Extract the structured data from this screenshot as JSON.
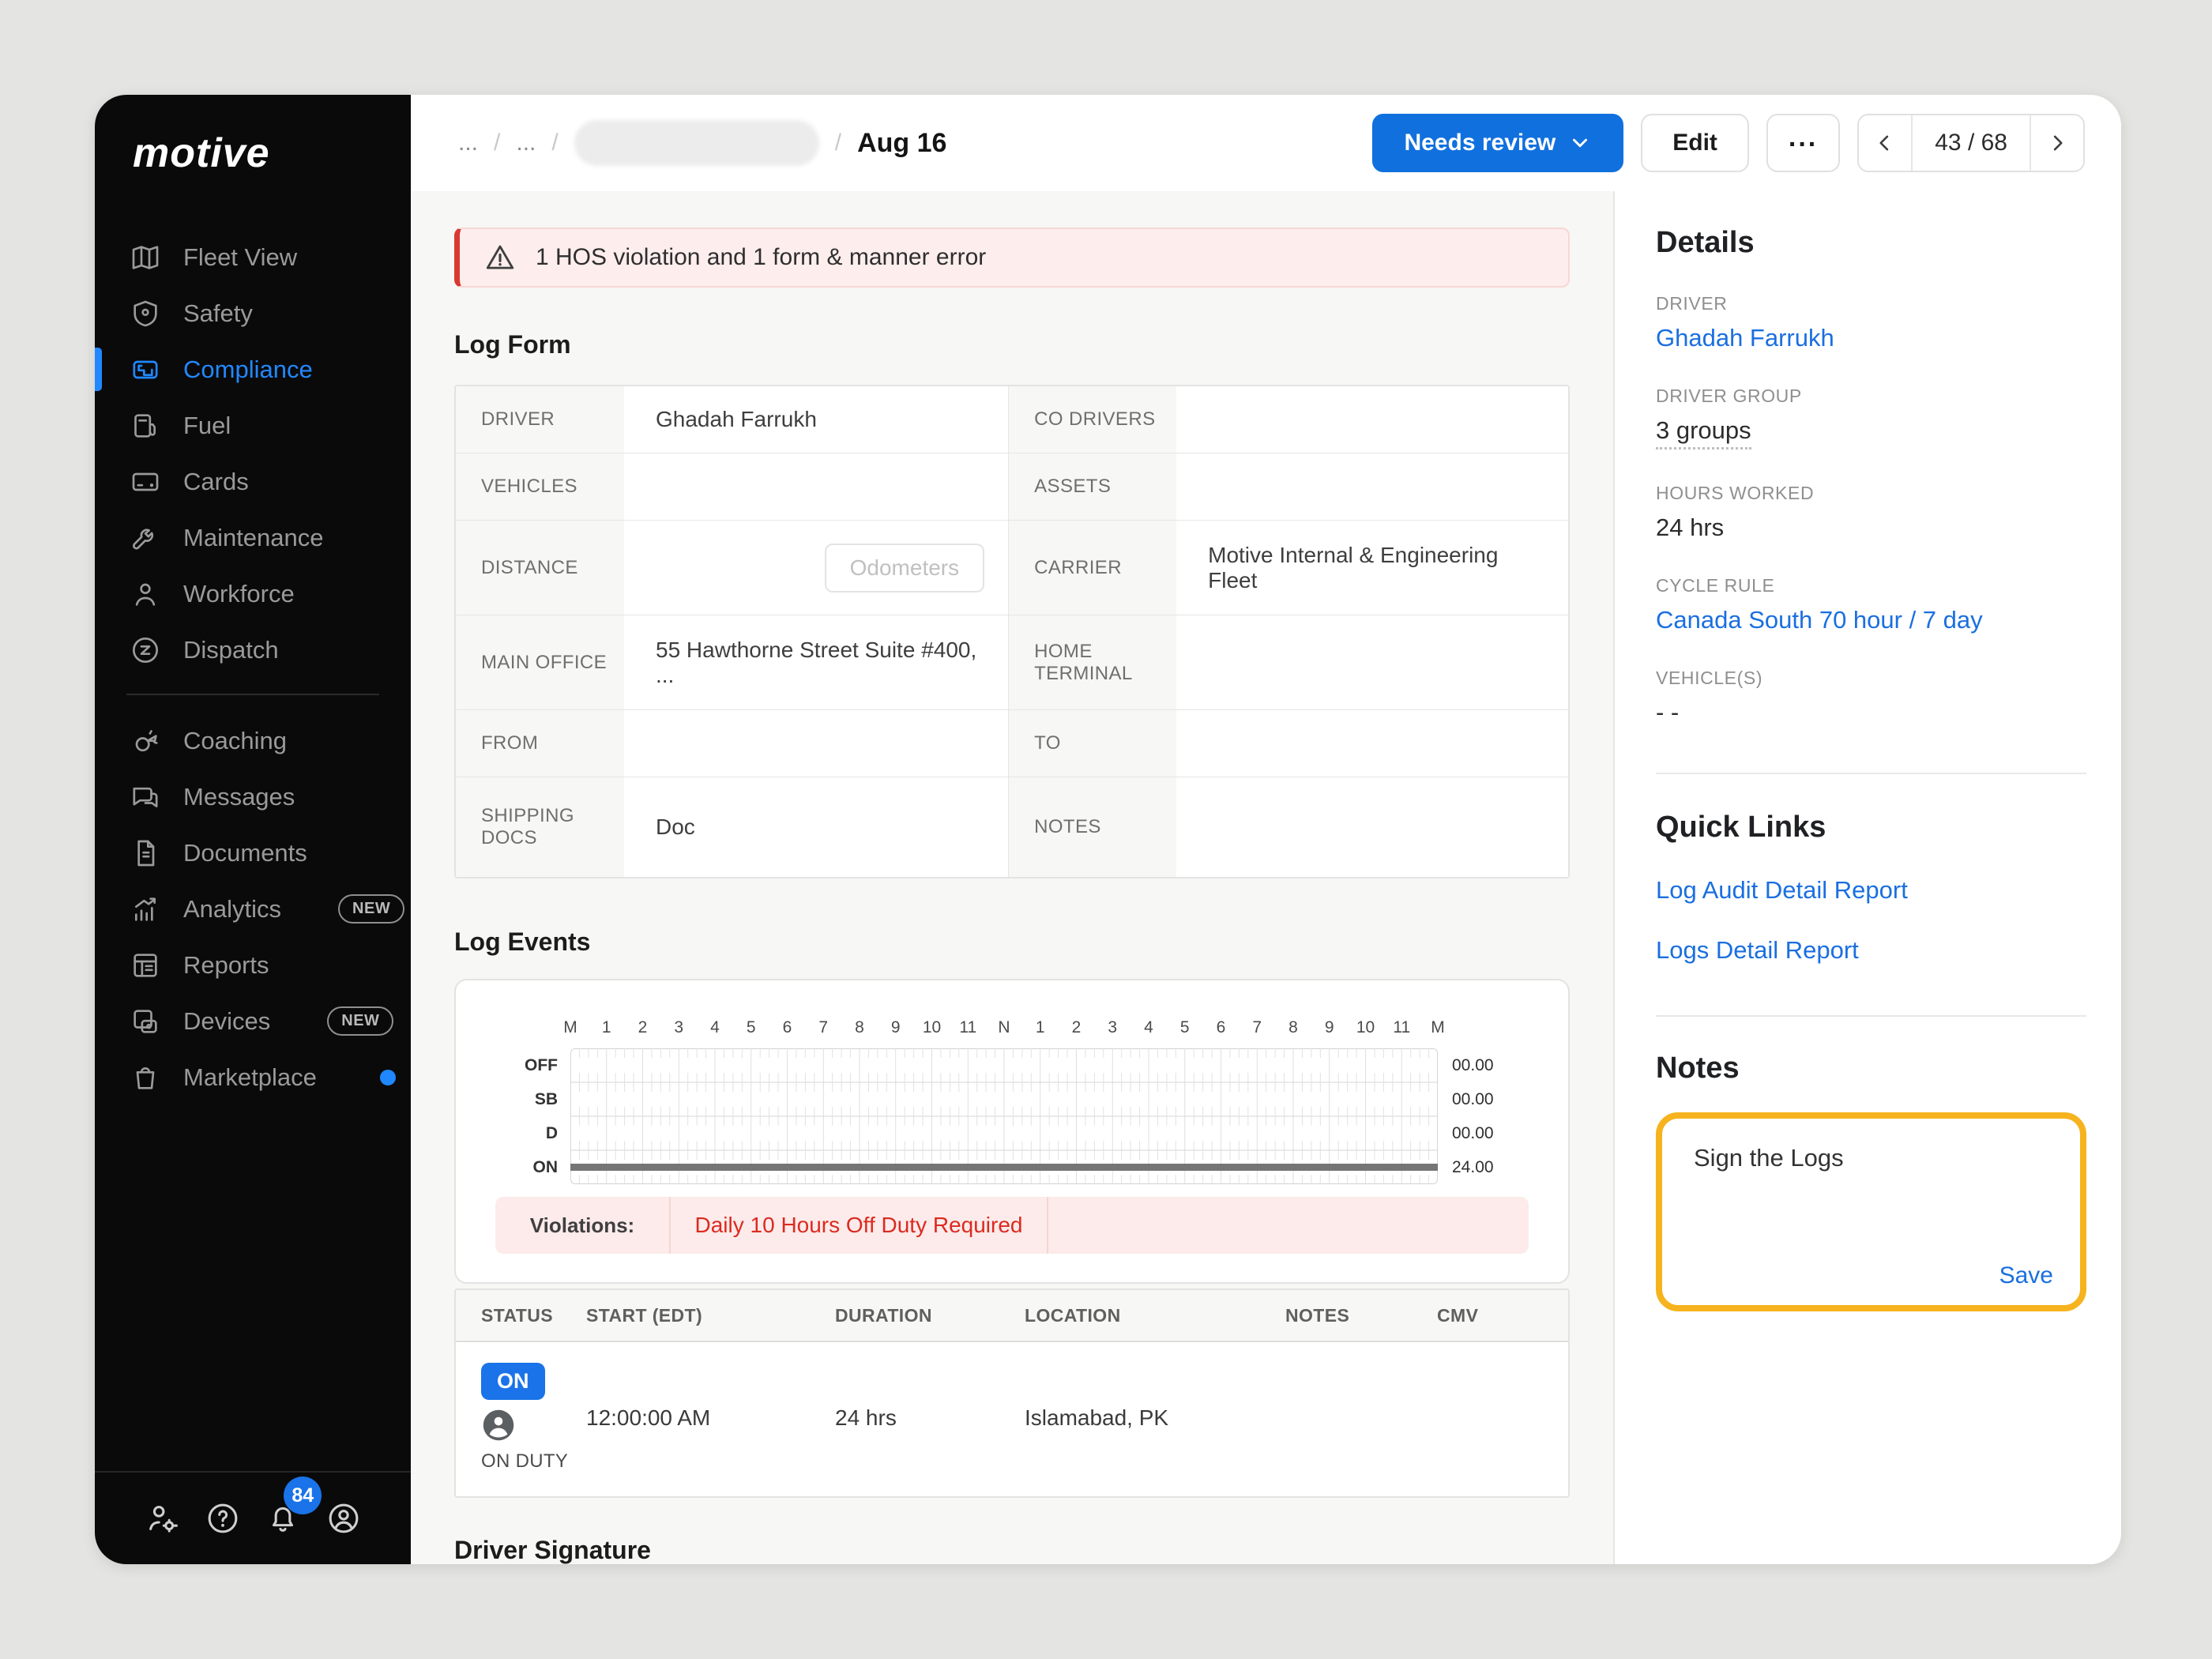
{
  "colors": {
    "accent_blue": "#1070de",
    "link_blue": "#1a6fe0",
    "badge_blue": "#1a73e8",
    "sidebar_active_blue": "#2288ff",
    "alert_red": "#d83a32",
    "violation_red": "#dc2a20",
    "notes_border_yellow": "#f6b31e"
  },
  "sidebar": {
    "logo": "motive",
    "items": [
      {
        "label": "Fleet View",
        "icon": "fleet-view"
      },
      {
        "label": "Safety",
        "icon": "safety"
      },
      {
        "label": "Compliance",
        "icon": "compliance",
        "active": true
      },
      {
        "label": "Fuel",
        "icon": "fuel"
      },
      {
        "label": "Cards",
        "icon": "cards"
      },
      {
        "label": "Maintenance",
        "icon": "maintenance"
      },
      {
        "label": "Workforce",
        "icon": "workforce"
      },
      {
        "label": "Dispatch",
        "icon": "dispatch"
      },
      {
        "divider": true
      },
      {
        "label": "Coaching",
        "icon": "coaching"
      },
      {
        "label": "Messages",
        "icon": "messages"
      },
      {
        "label": "Documents",
        "icon": "documents"
      },
      {
        "label": "Analytics",
        "icon": "analytics",
        "badge": "NEW"
      },
      {
        "label": "Reports",
        "icon": "reports"
      },
      {
        "label": "Devices",
        "icon": "devices",
        "badge": "NEW"
      },
      {
        "label": "Marketplace",
        "icon": "marketplace",
        "dot": true
      }
    ],
    "footer": {
      "icons": [
        "user-settings",
        "help",
        "notifications",
        "account"
      ],
      "notification_count": "84"
    }
  },
  "header": {
    "breadcrumb": {
      "items": [
        {
          "text": "..."
        },
        {
          "text": "..."
        },
        {
          "redacted": true
        },
        {
          "text": "Aug 16",
          "current": true
        }
      ],
      "separator": "/"
    },
    "status_button": "Needs review",
    "edit_label": "Edit",
    "more_label": "...",
    "pagination": {
      "current": "43",
      "total": "68",
      "display": "43 / 68"
    }
  },
  "alert": {
    "text": "1 HOS violation and 1 form & manner error"
  },
  "log_form": {
    "title": "Log Form",
    "odometers_placeholder": "Odometers",
    "rows": [
      {
        "l1": "DRIVER",
        "v1": "Ghadah Farrukh",
        "l2": "CO DRIVERS",
        "v2": "",
        "h": "row-h1"
      },
      {
        "l1": "VEHICLES",
        "v1": "",
        "l2": "ASSETS",
        "v2": "",
        "h": "row-h1"
      },
      {
        "l1": "DISTANCE",
        "v1": "",
        "v1_control": "odometers",
        "l2": "CARRIER",
        "v2": "Motive Internal & Engineering Fleet",
        "h": "row-h2"
      },
      {
        "l1": "MAIN OFFICE",
        "v1": "55 Hawthorne Street Suite #400, ...",
        "l2": "HOME TERMINAL",
        "v2": "",
        "h": "row-h2"
      },
      {
        "l1": "FROM",
        "v1": "",
        "l2": "TO",
        "v2": "",
        "h": "row-h1"
      },
      {
        "l1": "SHIPPING DOCS",
        "v1": "Doc",
        "l2": "NOTES",
        "v2": "",
        "h": "row-h3"
      }
    ]
  },
  "log_events": {
    "title": "Log Events",
    "chart_data": {
      "type": "hos-log-grid",
      "x_axis_labels": [
        "M",
        "1",
        "2",
        "3",
        "4",
        "5",
        "6",
        "7",
        "8",
        "9",
        "10",
        "11",
        "N",
        "1",
        "2",
        "3",
        "4",
        "5",
        "6",
        "7",
        "8",
        "9",
        "10",
        "11",
        "M"
      ],
      "x_range": [
        0,
        24
      ],
      "rows": [
        {
          "label": "OFF",
          "total": "00.00"
        },
        {
          "label": "SB",
          "total": "00.00"
        },
        {
          "label": "D",
          "total": "00.00"
        },
        {
          "label": "ON",
          "total": "24.00"
        }
      ],
      "segments": [
        {
          "row": "ON",
          "start": 0,
          "end": 24
        }
      ],
      "grid": true
    },
    "violations_label": "Violations:",
    "violation": "Daily 10 Hours Off Duty Required"
  },
  "events_table": {
    "columns": [
      "STATUS",
      "START (EDT)",
      "DURATION",
      "LOCATION",
      "NOTES",
      "CMV"
    ],
    "row": {
      "status_badge": "ON",
      "status_label": "ON DUTY",
      "start": "12:00:00 AM",
      "duration": "24 hrs",
      "location": "Islamabad, PK",
      "notes": "",
      "cmv": ""
    }
  },
  "driver_signature_title": "Driver Signature",
  "details": {
    "title": "Details",
    "fields": [
      {
        "label": "DRIVER",
        "value": "Ghadah Farrukh",
        "style": "link"
      },
      {
        "label": "DRIVER GROUP",
        "value": "3 groups",
        "style": "dotted"
      },
      {
        "label": "HOURS WORKED",
        "value": "24 hrs"
      },
      {
        "label": "CYCLE RULE",
        "value": "Canada South 70 hour / 7 day",
        "style": "link"
      },
      {
        "label": "VEHICLE(S)",
        "value": "- -"
      }
    ]
  },
  "quick_links": {
    "title": "Quick Links",
    "links": [
      "Log Audit Detail Report",
      "Logs Detail Report"
    ]
  },
  "notes": {
    "title": "Notes",
    "value": "Sign the Logs",
    "save_label": "Save"
  }
}
